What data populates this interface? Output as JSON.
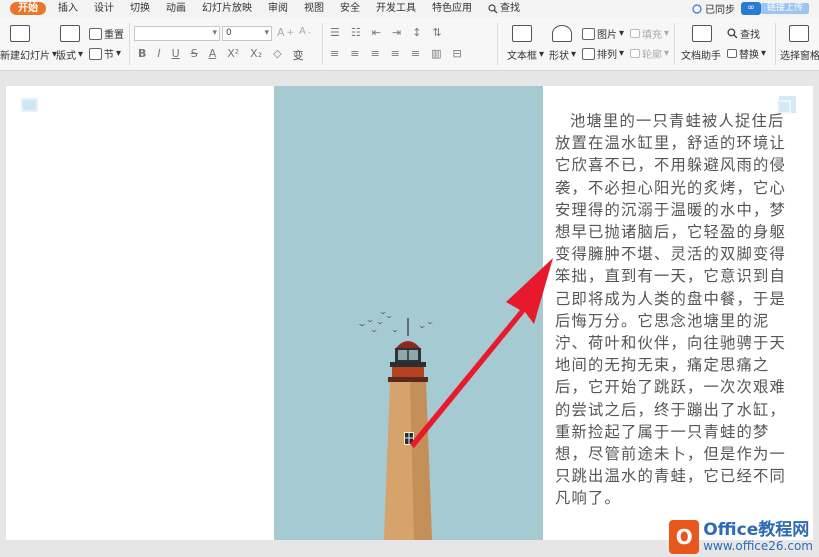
{
  "menu": {
    "tabs": [
      "开始",
      "插入",
      "设计",
      "切换",
      "动画",
      "幻灯片放映",
      "审阅",
      "视图",
      "安全",
      "开发工具",
      "特色应用"
    ],
    "search_label": "查找",
    "sync_label": "已同步",
    "upload_label": "链接上传"
  },
  "ribbon": {
    "new_slide": "新建幻灯片",
    "layout": "版式",
    "reset": "重置",
    "section": "节",
    "font_size_value": "0",
    "textbox": "文本框",
    "shape": "形状",
    "picture": "图片",
    "arrange": "排列",
    "fill": "填充",
    "outline": "轮廓",
    "doc_assistant": "文档助手",
    "find": "查找",
    "replace": "替换",
    "select_pane": "选择窗格"
  },
  "slide": {
    "body_text": "池塘里的一只青蛙被人捉住后放置在温水缸里，舒适的环境让它欣喜不已，不用躲避风雨的侵袭，不必担心阳光的炙烤，它心安理得的沉溺于温暖的水中，梦想早已抛诸脑后，它轻盈的身躯变得臃肿不堪、灵活的双脚变得笨拙，直到有一天，它意识到自己即将成为人类的盘中餐，于是后悔万分。它思念池塘里的泥泞、荷叶和伙伴，向往驰骋于天地间的无拘无束，痛定思痛之后，它开始了跳跃，一次次艰难的尝试之后，终于蹦出了水缸，重新捡起了属于一只青蛙的梦想，尽管前途未卜，但是作为一只跳出温水的青蛙，它已经不同凡响了。"
  },
  "watermark": {
    "logo_char": "O",
    "line1": "Office教程网",
    "line2": "www.office26.com"
  },
  "colors": {
    "accent": "#e8762d",
    "arrow": "#e8192c",
    "sky": "#a6cad1"
  }
}
